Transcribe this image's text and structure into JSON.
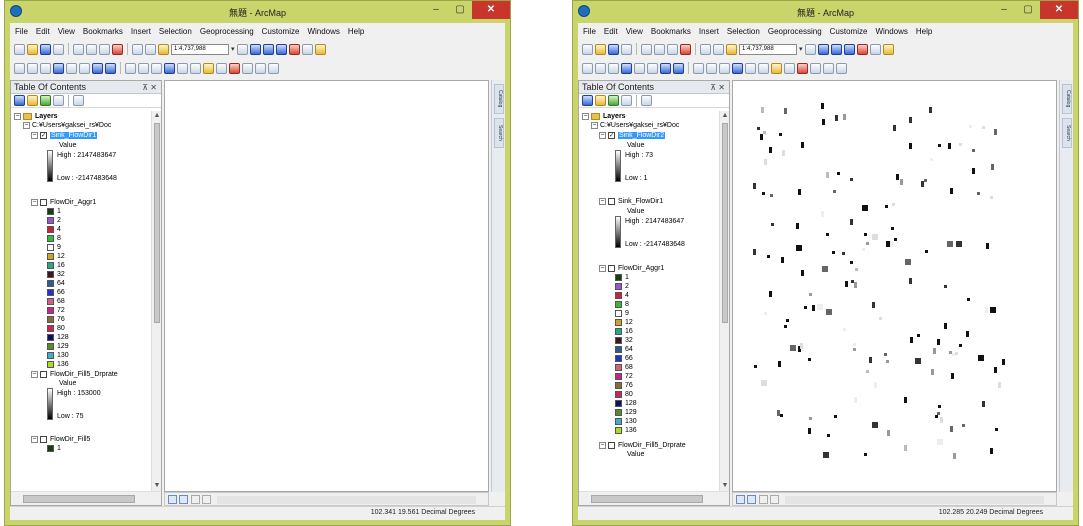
{
  "app": {
    "colors": {
      "title_bar": "#c9d46a",
      "close_button": "#c7352b",
      "selection": "#3399ff"
    }
  },
  "windows": [
    {
      "title": "無題 - ArcMap",
      "menu": [
        "File",
        "Edit",
        "View",
        "Bookmarks",
        "Insert",
        "Selection",
        "Geoprocessing",
        "Customize",
        "Windows",
        "Help"
      ],
      "scale": "1:4,737,988",
      "toc_title": "Table Of Contents",
      "layers_label": "Layers",
      "path_label": "C:¥Users¥gaksei_rs¥Doc",
      "layers": [
        {
          "name": "Sink_FlowDir1",
          "selected": true,
          "checked": true,
          "value_label": "Value",
          "high": "High : 2147483647",
          "low": "Low : -2147483648"
        },
        {
          "name": "FlowDir_Aggr1",
          "checked": false
        },
        {
          "name": "FlowDir_Fill5_Drprate",
          "checked": false,
          "value_label": "Value",
          "high": "High : 153000",
          "low": "Low : 75"
        },
        {
          "name": "FlowDir_Fill5",
          "checked": false
        }
      ],
      "legend_values": [
        "1",
        "2",
        "4",
        "8",
        "9",
        "12",
        "16",
        "32",
        "64",
        "66",
        "68",
        "72",
        "76",
        "80",
        "128",
        "129",
        "130",
        "136"
      ],
      "status_coords": "102.341  19.561 Decimal Degrees"
    },
    {
      "title": "無題 - ArcMap",
      "menu": [
        "File",
        "Edit",
        "View",
        "Bookmarks",
        "Insert",
        "Selection",
        "Geoprocessing",
        "Customize",
        "Windows",
        "Help"
      ],
      "scale": "1:4,737,988",
      "toc_title": "Table Of Contents",
      "layers_label": "Layers",
      "path_label": "C:¥Users¥gaksei_rs¥Doc",
      "layers": [
        {
          "name": "Sink_FlowDir2",
          "selected": true,
          "checked": true,
          "value_label": "Value",
          "high": "High : 73",
          "low": "Low : 1"
        },
        {
          "name": "Sink_FlowDir1",
          "checked": false,
          "value_label": "Value",
          "high": "High : 2147483647",
          "low": "Low : -2147483648"
        },
        {
          "name": "FlowDir_Aggr1",
          "checked": false
        },
        {
          "name": "FlowDir_Fill5_Drprate",
          "checked": false,
          "value_label": "Value"
        }
      ],
      "legend_values": [
        "1",
        "2",
        "4",
        "8",
        "9",
        "12",
        "16",
        "32",
        "64",
        "66",
        "68",
        "72",
        "76",
        "80",
        "128",
        "129",
        "130",
        "136"
      ],
      "status_coords": "102.285  20.249 Decimal Degrees"
    }
  ],
  "legend_colors": [
    "#1a3a1a",
    "#9955cc",
    "#cc2233",
    "#33bb33",
    "#ffffff",
    "#d4a020",
    "#22aa88",
    "#401818",
    "#2a5a9a",
    "#2233cc",
    "#d06088",
    "#cc2288",
    "#8a6a3a",
    "#d4205a",
    "#101060",
    "#5a8a2a",
    "#44aacc",
    "#aadd22",
    "#333333"
  ],
  "side_tabs": [
    "Catalog",
    "Search"
  ]
}
